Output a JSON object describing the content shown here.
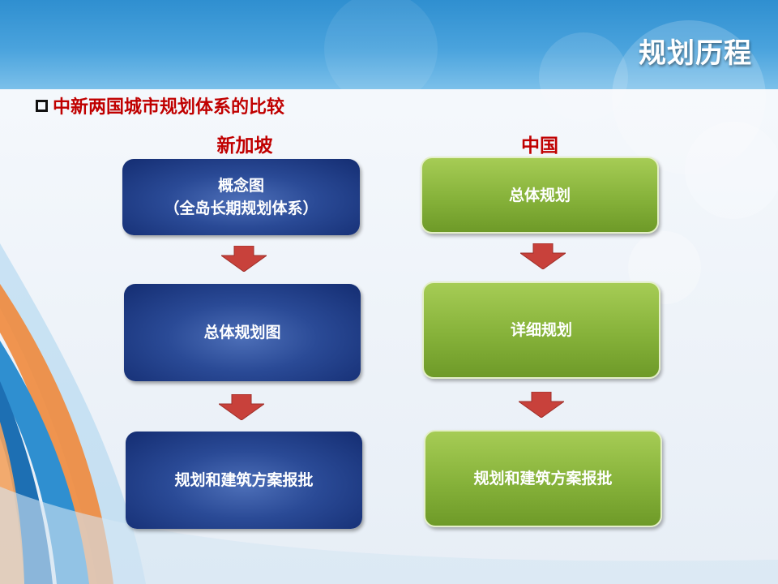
{
  "slide": {
    "title": "规划历程",
    "subtitle": "中新两国城市规划体系的比较"
  },
  "singapore": {
    "heading": "新加坡",
    "steps": [
      {
        "line1": "概念图",
        "line2": "（全岛长期规划体系）"
      },
      {
        "line1": "总体规划图",
        "line2": ""
      },
      {
        "line1": "规划和建筑方案报批",
        "line2": ""
      }
    ]
  },
  "china": {
    "heading": "中国",
    "steps": [
      {
        "line1": "总体规划"
      },
      {
        "line1": "详细规划"
      },
      {
        "line1": "规划和建筑方案报批"
      }
    ]
  },
  "colors": {
    "heading_red": "#c00000",
    "navy_box": "#1f3b87",
    "green_box": "#86b23a",
    "arrow_red": "#c8413b",
    "header_blue": "#2f8fd0"
  },
  "icons": [
    "square-bullet-icon",
    "down-arrow-icon"
  ]
}
